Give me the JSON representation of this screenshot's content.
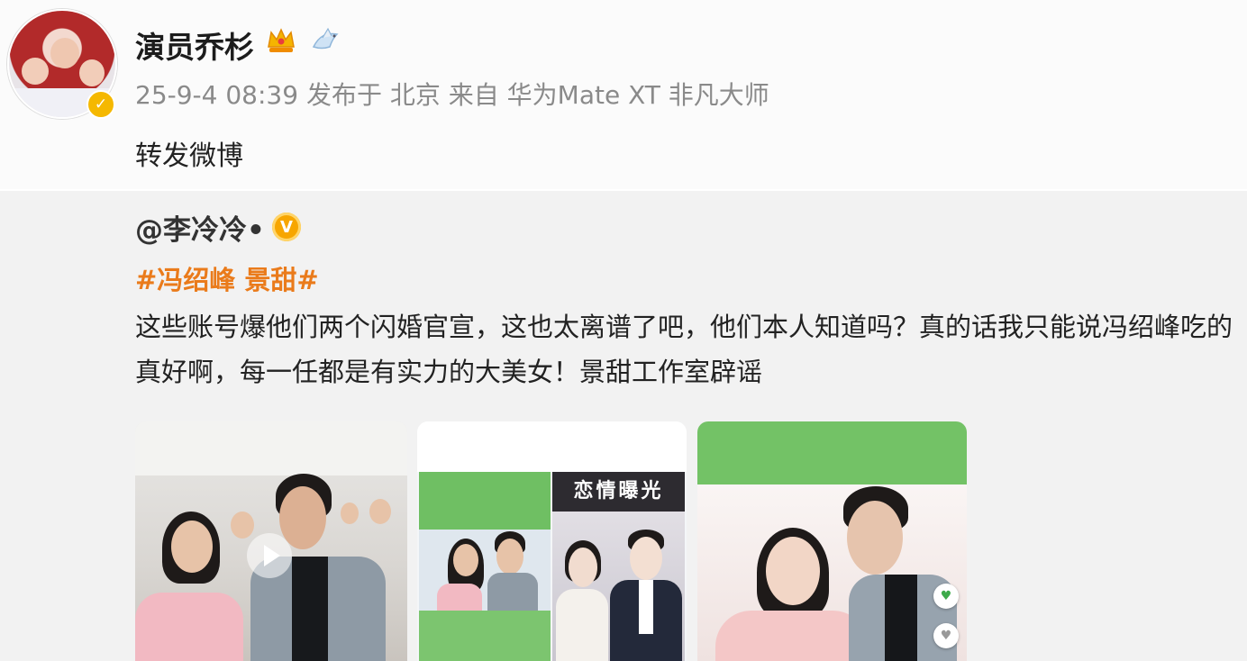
{
  "post": {
    "username": "演员乔杉",
    "meta": "25-9-4 08:39 发布于 北京 来自 华为Mate XT 非凡大师",
    "repost_text": "转发微博"
  },
  "quoted": {
    "author": "@李冷冷•",
    "hashtags": "#冯绍峰 景甜#",
    "body": "这些账号爆他们两个闪婚官宣，这也太离谱了吧，他们本人知道吗？真的话我只能说冯绍峰吃的真好啊，每一任都是有实力的大美女！景甜工作室辟谣",
    "images": [
      {
        "kind": "video"
      },
      {
        "banner": "恋情曝光"
      },
      {
        "kind": "photo"
      }
    ]
  },
  "colors": {
    "hashtag": "#ea7b1b",
    "verified": "#f5b800",
    "quoted_bg": "#f2f2f2",
    "green": "#73c266"
  },
  "icons": [
    "crown-icon",
    "bird-icon",
    "verified-icon",
    "play-icon"
  ]
}
